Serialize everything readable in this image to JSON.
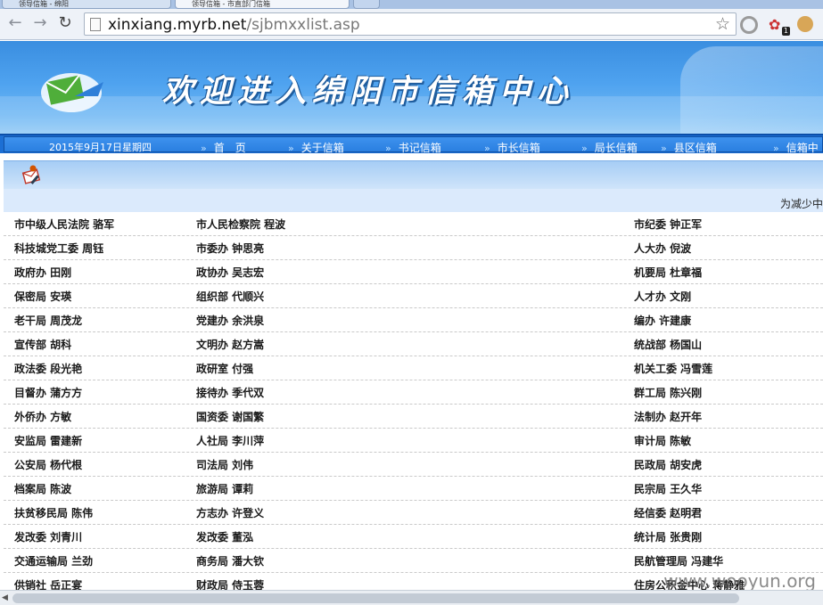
{
  "browser": {
    "tabs": [
      {
        "label": "领导信箱 - 绵阳"
      },
      {
        "label": "领导信箱 - 市直部门信箱"
      },
      {
        "label": ""
      }
    ],
    "url_host": "xinxiang.myrb.net",
    "url_path": "/sjbmxxlist.asp",
    "back_glyph": "←",
    "forward_glyph": "→",
    "reload_glyph": "↻",
    "star_glyph": "☆",
    "ext_badge": "1",
    "icons": [
      "page-icon",
      "bookmark-star-icon",
      "extension-circle-icon",
      "extension-share-icon",
      "cookie-icon"
    ]
  },
  "banner": {
    "title": "欢迎进入绵阳市信箱中心",
    "colors": {
      "sky_top": "#3a8ee0",
      "sky_bottom": "#8ec8f6"
    }
  },
  "navbar": {
    "date": "2015年9月17日星期四",
    "items": [
      "首　页",
      "关于信箱",
      "书记信箱",
      "市长信箱",
      "局长信箱",
      "县区信箱",
      "信箱中"
    ],
    "arrow": "»"
  },
  "notice": "为减少中",
  "directory": {
    "rows": [
      [
        "市中级人民法院  骆军",
        "市人民检察院  程波",
        "市纪委  钟正军"
      ],
      [
        "科技城党工委  周钰",
        "市委办  钟思亮",
        "人大办  倪波"
      ],
      [
        "政府办  田刚",
        "政协办  吴志宏",
        "机要局  杜章福"
      ],
      [
        "保密局  安瑛",
        "组织部  代顺兴",
        "人才办  文刚"
      ],
      [
        "老干局  周茂龙",
        "党建办  余洪泉",
        "编办  许建康"
      ],
      [
        "宣传部  胡科",
        "文明办  赵方嵩",
        "统战部  杨国山"
      ],
      [
        "政法委  段光艳",
        "政研室  付强",
        "机关工委  冯雪莲"
      ],
      [
        "目督办  蒲方方",
        "接待办  季代双",
        "群工局  陈兴刚"
      ],
      [
        "外侨办  方敏",
        "国资委  谢国繁",
        "法制办  赵开年"
      ],
      [
        "安监局  雷建新",
        "人社局  李川萍",
        "审计局  陈敏"
      ],
      [
        "公安局  杨代根",
        "司法局  刘伟",
        "民政局  胡安虎"
      ],
      [
        "档案局  陈波",
        "旅游局  谭莉",
        "民宗局  王久华"
      ],
      [
        "扶贫移民局  陈伟",
        "方志办  许登义",
        "经信委  赵明君"
      ],
      [
        "发改委  刘青川",
        "发改委  董泓",
        "统计局  张贵刚"
      ],
      [
        "交通运输局  兰劲",
        "商务局  潘大钦",
        "民航管理局  冯建华"
      ],
      [
        "供销社  岳正宴",
        "财政局  侍玉蓉",
        "住房公积金中心  蒋静雅"
      ]
    ]
  },
  "watermark": "www.wooyun.org"
}
